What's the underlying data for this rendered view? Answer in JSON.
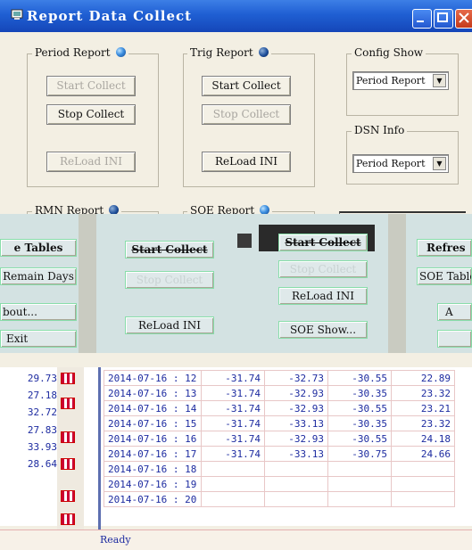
{
  "window": {
    "title": "Report Data Collect"
  },
  "period_report": {
    "label": "Period Report",
    "start_label": "Start Collect",
    "stop_label": "Stop Collect",
    "reload_label": "ReLoad INI"
  },
  "trig_report": {
    "label": "Trig Report",
    "start_label": "Start Collect",
    "stop_label": "Stop Collect",
    "reload_label": "ReLoad INI"
  },
  "config_show": {
    "label": "Config Show",
    "selected": "Period Report"
  },
  "dsn_info": {
    "label": "DSN Info",
    "selected": "Period Report"
  },
  "rmn_report": {
    "label": "RMN Report"
  },
  "soe_report": {
    "label": "SOE Report"
  },
  "glitch": {
    "tables_label": "e Tables",
    "remain_days_label": "Remain Days",
    "about_label": "bout...",
    "exit_label": "Exit",
    "start_collect_label": "Start Collect",
    "stop_collect_label": "Stop Collect",
    "reload_label": "ReLoad INI",
    "soe_start_label": "Start Collect",
    "soe_stop_label": "Stop Collect",
    "soe_reload_label": "ReLoad INI",
    "soe_show_label": "SOE Show...",
    "refresh_label": "Refres",
    "soe_tables_label": "SOE Table",
    "cut_label": "A"
  },
  "left_values": [
    "29.73",
    "27.18",
    "32.72",
    "27.83",
    "33.93",
    "28.64"
  ],
  "table_rows": [
    [
      "2014-07-16 : 12",
      "-31.74",
      "-32.73",
      "-30.55",
      "22.89"
    ],
    [
      "2014-07-16 : 13",
      "-31.74",
      "-32.93",
      "-30.35",
      "23.32"
    ],
    [
      "2014-07-16 : 14",
      "-31.74",
      "-32.93",
      "-30.55",
      "23.21"
    ],
    [
      "2014-07-16 : 15",
      "-31.74",
      "-33.13",
      "-30.35",
      "23.32"
    ],
    [
      "2014-07-16 : 16",
      "-31.74",
      "-32.93",
      "-30.55",
      "24.18"
    ],
    [
      "2014-07-16 : 17",
      "-31.74",
      "-33.13",
      "-30.75",
      "24.66"
    ],
    [
      "2014-07-16 : 18",
      "",
      "",
      "",
      ""
    ],
    [
      "2014-07-16 : 19",
      "",
      "",
      "",
      ""
    ],
    [
      "2014-07-16 : 20",
      "",
      "",
      "",
      ""
    ]
  ],
  "status_bar": {
    "text": "Ready"
  },
  "colors": {
    "titlebar": "#1f5fd3",
    "table_text": "#1d2ba0",
    "led": "#3d8fe0"
  }
}
